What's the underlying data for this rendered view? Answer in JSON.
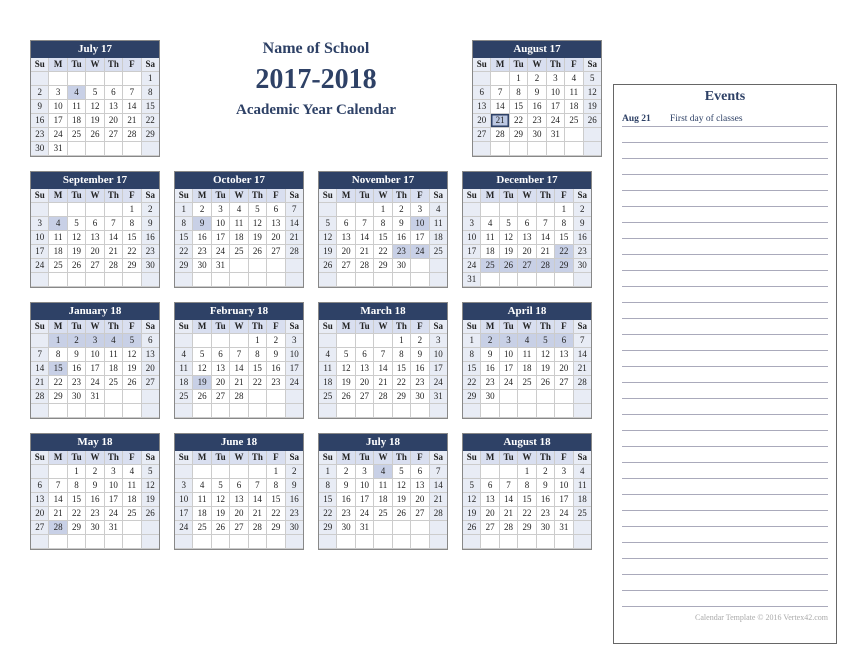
{
  "header": {
    "school": "Name of School",
    "years": "2017-2018",
    "subtitle": "Academic Year Calendar"
  },
  "events": {
    "title": "Events",
    "rows": [
      {
        "date": "Aug 21",
        "text": "First day of classes"
      }
    ],
    "blank_rows": 30,
    "credit": "Calendar Template © 2016 Vertex42.com"
  },
  "dow": [
    "Su",
    "M",
    "Tu",
    "W",
    "Th",
    "F",
    "Sa"
  ],
  "months": [
    {
      "title": "July 17",
      "start": 6,
      "days": 31,
      "shaded": [
        4
      ],
      "hi": []
    },
    {
      "title": "August 17",
      "start": 2,
      "days": 31,
      "shaded": [],
      "hi": [
        21
      ]
    },
    {
      "title": "September 17",
      "start": 5,
      "days": 30,
      "shaded": [
        4
      ],
      "hi": []
    },
    {
      "title": "October 17",
      "start": 0,
      "days": 31,
      "shaded": [
        9
      ],
      "hi": []
    },
    {
      "title": "November 17",
      "start": 3,
      "days": 30,
      "shaded": [
        10,
        23,
        24
      ],
      "hi": []
    },
    {
      "title": "December 17",
      "start": 5,
      "days": 31,
      "shaded": [
        22,
        25,
        26,
        27,
        28,
        29
      ],
      "hi": []
    },
    {
      "title": "January 18",
      "start": 1,
      "days": 31,
      "shaded": [
        1,
        2,
        3,
        4,
        5,
        15
      ],
      "hi": []
    },
    {
      "title": "February 18",
      "start": 4,
      "days": 28,
      "shaded": [
        19
      ],
      "hi": []
    },
    {
      "title": "March 18",
      "start": 4,
      "days": 31,
      "shaded": [],
      "hi": []
    },
    {
      "title": "April 18",
      "start": 0,
      "days": 30,
      "shaded": [
        2,
        3,
        4,
        5,
        6
      ],
      "hi": []
    },
    {
      "title": "May 18",
      "start": 2,
      "days": 31,
      "shaded": [
        28
      ],
      "hi": []
    },
    {
      "title": "June 18",
      "start": 5,
      "days": 30,
      "shaded": [],
      "hi": []
    },
    {
      "title": "July 18",
      "start": 0,
      "days": 31,
      "shaded": [
        4
      ],
      "hi": []
    },
    {
      "title": "August 18",
      "start": 3,
      "days": 31,
      "shaded": [],
      "hi": []
    }
  ]
}
